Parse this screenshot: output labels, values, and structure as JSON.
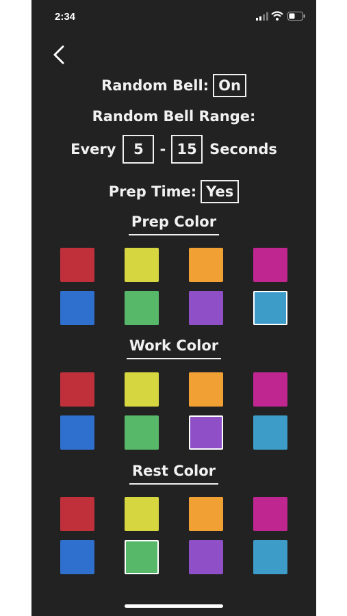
{
  "status": {
    "time": "2:34"
  },
  "settings": {
    "random_bell_label": "Random Bell:",
    "random_bell_value": "On",
    "range_label": "Random Bell Range:",
    "every_label": "Every",
    "range_min": "5",
    "range_dash": "-",
    "range_max": "15",
    "seconds_label": "Seconds",
    "prep_time_label": "Prep Time:",
    "prep_time_value": "Yes"
  },
  "palette": [
    "#c0303a",
    "#d6d640",
    "#f1a034",
    "#c0268f",
    "#2f6fce",
    "#58b86a",
    "#8f4fc7",
    "#3d9cc8"
  ],
  "palette_names": [
    "red",
    "yellow",
    "orange",
    "magenta",
    "blue",
    "green",
    "purple",
    "teal"
  ],
  "sections": [
    {
      "title": "Prep Color",
      "selected_index": 7
    },
    {
      "title": "Work Color",
      "selected_index": 6
    },
    {
      "title": "Rest Color",
      "selected_index": 5
    }
  ]
}
